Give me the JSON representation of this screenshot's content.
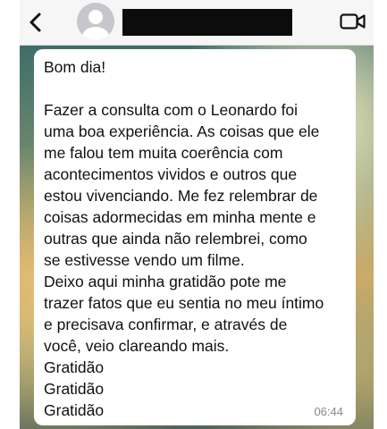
{
  "header": {
    "contact_name": "",
    "back_icon": "chevron-left-icon",
    "avatar_icon": "person-placeholder-icon",
    "video_icon": "video-camera-icon",
    "name_redacted": true
  },
  "message": {
    "text": "Bom dia!\n\nFazer a consulta com o Leonardo foi\numa boa experiência. As coisas que ele\nme falou tem muita coerência com\nacontecimentos vividos e outros que\nestou vivenciando. Me fez relembrar de\ncoisas adormecidas em minha mente e\noutras que ainda não relembrei, como\nse estivesse vendo um filme.\nDeixo aqui minha gratidão pote me\ntrazer fatos que eu sentia no meu íntimo\ne precisava confirmar, e através de\nvocê, veio clareando mais.\nGratidão\nGratidão\nGratidão",
    "time": "06:44"
  },
  "colors": {
    "header_bg": "#f6f6f6",
    "bubble_bg": "#ffffff",
    "redaction": "#0c0c0c",
    "time_text": "#8a8a8a"
  }
}
